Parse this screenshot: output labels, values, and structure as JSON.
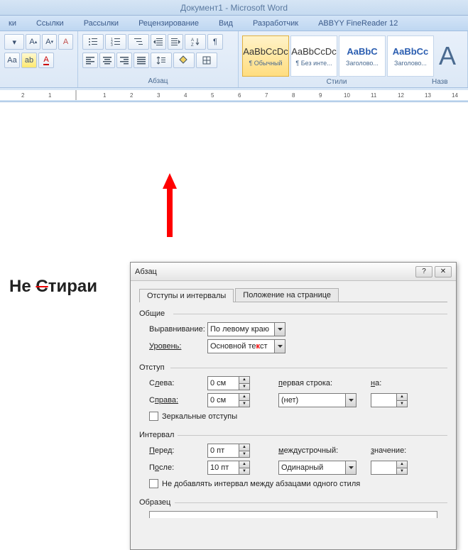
{
  "title": "Документ1 - Microsoft Word",
  "tabs": [
    "ки",
    "Ссылки",
    "Рассылки",
    "Рецензирование",
    "Вид",
    "Разработчик",
    "ABBYY FineReader 12"
  ],
  "ribbon_labels": {
    "para": "Абзац",
    "styles": "Стили",
    "change": "Назв"
  },
  "styles": [
    {
      "prev": "AaBbCcDc",
      "name": "¶ Обычный",
      "sel": true,
      "cls": ""
    },
    {
      "prev": "AaBbCcDc",
      "name": "¶ Без инте...",
      "sel": false,
      "cls": ""
    },
    {
      "prev": "AaBbC",
      "name": "Заголово...",
      "sel": false,
      "cls": "blue"
    },
    {
      "prev": "AaBbCc",
      "name": "Заголово...",
      "sel": false,
      "cls": "blue"
    }
  ],
  "bigtext_parts": {
    "a": "Не ",
    "b": "С",
    "c": "тираи"
  },
  "dialog": {
    "title": "Абзац",
    "tabs": [
      "Отступы и интервалы",
      "Положение на странице"
    ],
    "general": {
      "hd": "Общие",
      "align_lbl": "Выравнивание:",
      "align_val": "По левому краю",
      "level_lbl": "Уровень:",
      "level_val": "Основной те",
      "level_val2": "ст"
    },
    "indent": {
      "hd": "Отступ",
      "left_lbl": "Слева:",
      "left_l": "С",
      "left_val": "0 см",
      "right_lbl": "права:",
      "right_l": "С",
      "right_val": "0 см",
      "first_lbl": "ервая строка:",
      "first_l": "п",
      "first_val": "(нет)",
      "by_lbl": "а:",
      "by_l": "н",
      "mirror": "Зеркальные отступы"
    },
    "spacing": {
      "hd": "Интервал",
      "before_lbl": "еред:",
      "before_l": "П",
      "before_val": "0 пт",
      "after_lbl": "осле:",
      "after_l": "П",
      "after_val": "10 пт",
      "line_lbl": "еждустрочный:",
      "line_l": "м",
      "line_val": "Одинарный",
      "val_lbl": "начение:",
      "val_l": "з",
      "nogap": "Не добавлять интервал между абзацами одного стиля"
    },
    "sample": {
      "hd": "Образец"
    }
  }
}
